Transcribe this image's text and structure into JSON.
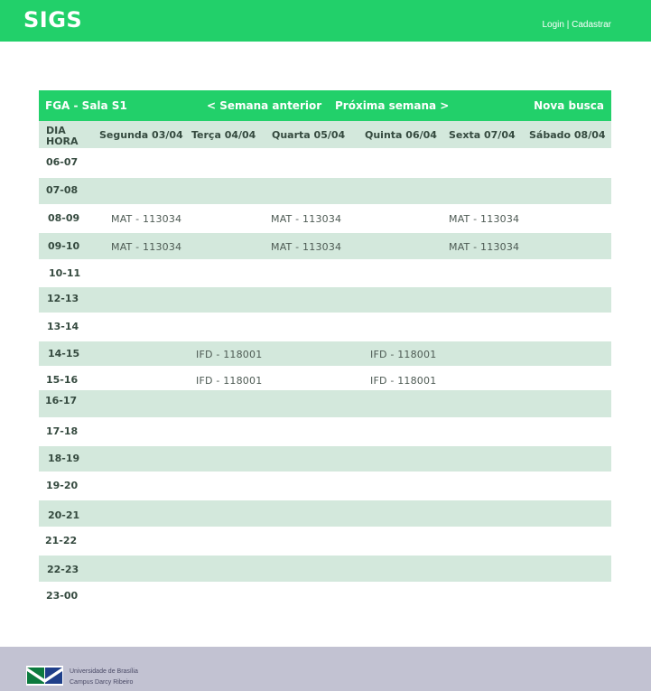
{
  "app": {
    "title": "SIGS"
  },
  "auth": {
    "login": "Login",
    "separator": "|",
    "register": "Cadastrar"
  },
  "schedule": {
    "room": "FGA - Sala S1",
    "prev_week": "< Semana anterior",
    "next_week": "Próxima semana >",
    "new_search": "Nova busca",
    "corner_day": "DIA",
    "corner_hour": "HORA",
    "days": [
      "Segunda 03/04",
      "Terça 04/04",
      "Quarta 05/04",
      "Quinta 06/04",
      "Sexta 07/04",
      "Sábado 08/04"
    ],
    "rows": [
      {
        "hour": "06-07",
        "cells": [
          "",
          "",
          "",
          "",
          "",
          ""
        ]
      },
      {
        "hour": "07-08",
        "cells": [
          "",
          "",
          "",
          "",
          "",
          ""
        ]
      },
      {
        "hour": "08-09",
        "cells": [
          "MAT - 113034",
          "",
          "MAT - 113034",
          "",
          "MAT - 113034",
          ""
        ]
      },
      {
        "hour": "09-10",
        "cells": [
          "MAT - 113034",
          "",
          "MAT - 113034",
          "",
          "MAT - 113034",
          ""
        ]
      },
      {
        "hour": "10-11",
        "cells": [
          "",
          "",
          "",
          "",
          "",
          ""
        ]
      },
      {
        "hour": "12-13",
        "cells": [
          "",
          "",
          "",
          "",
          "",
          ""
        ]
      },
      {
        "hour": "13-14",
        "cells": [
          "",
          "",
          "",
          "",
          "",
          ""
        ]
      },
      {
        "hour": "14-15",
        "cells": [
          "",
          "IFD - 118001",
          "",
          "IFD - 118001",
          "",
          ""
        ]
      },
      {
        "hour": "15-16",
        "cells": [
          "",
          "IFD - 118001",
          "",
          "IFD - 118001",
          "",
          ""
        ]
      },
      {
        "hour": "16-17",
        "cells": [
          "",
          "",
          "",
          "",
          "",
          ""
        ]
      },
      {
        "hour": "17-18",
        "cells": [
          "",
          "",
          "",
          "",
          "",
          ""
        ]
      },
      {
        "hour": "18-19",
        "cells": [
          "",
          "",
          "",
          "",
          "",
          ""
        ]
      },
      {
        "hour": "19-20",
        "cells": [
          "",
          "",
          "",
          "",
          "",
          ""
        ]
      },
      {
        "hour": "20-21",
        "cells": [
          "",
          "",
          "",
          "",
          "",
          ""
        ]
      },
      {
        "hour": "21-22",
        "cells": [
          "",
          "",
          "",
          "",
          "",
          ""
        ]
      },
      {
        "hour": "22-23",
        "cells": [
          "",
          "",
          "",
          "",
          "",
          ""
        ]
      },
      {
        "hour": "23-00",
        "cells": [
          "",
          "",
          "",
          "",
          "",
          ""
        ]
      }
    ]
  },
  "footer": {
    "line1": "Universidade de Brasília",
    "line2": "Campus Darcy Ribeiro"
  },
  "colors": {
    "accent": "#22d06a",
    "row_alt": "#d3e8dc",
    "footer_bg": "#c2c2d2"
  }
}
